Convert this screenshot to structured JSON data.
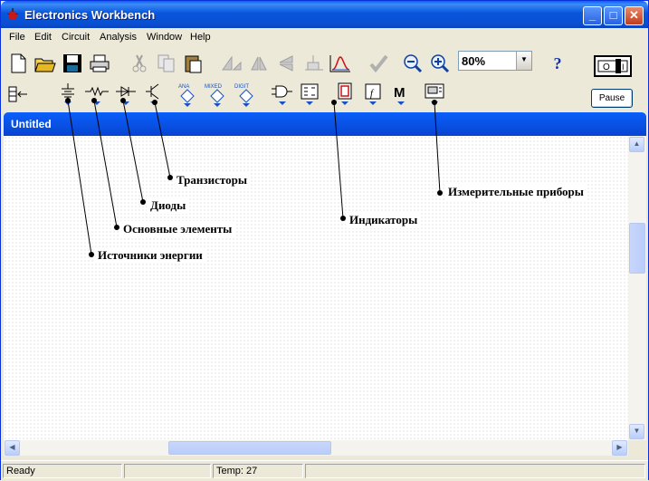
{
  "app": {
    "title": "Electronics Workbench"
  },
  "menu": {
    "items": [
      "File",
      "Edit",
      "Circuit",
      "Analysis",
      "Window",
      "Help"
    ]
  },
  "toolbar": {
    "zoom_value": "80%",
    "help_glyph": "?",
    "pause_label": "Pause",
    "bin_labels": {
      "ana": "ANA",
      "mixed": "MIXED",
      "digit": "DIGIT",
      "misc": "M"
    }
  },
  "child_window": {
    "title": "Untitled"
  },
  "callouts": {
    "transistors": "Транзисторы",
    "measuring": "Измерительные приборы",
    "diodes": "Диоды",
    "indicators": "Индикаторы",
    "basic": "Основные элементы",
    "sources": "Источники энергии"
  },
  "status": {
    "ready": "Ready",
    "temp": "Temp:  27"
  },
  "colors": {
    "title_blue": "#0a5ffb",
    "window_bg": "#ece9d8",
    "close_red": "#c23c1c"
  }
}
